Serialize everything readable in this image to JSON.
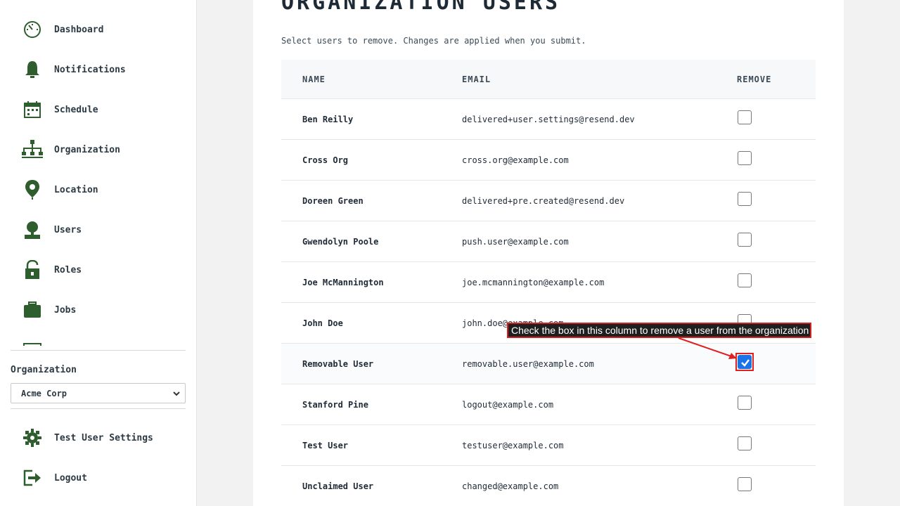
{
  "sidebar": {
    "items": [
      {
        "label": "Dashboard",
        "icon": "dashboard-icon"
      },
      {
        "label": "Notifications",
        "icon": "bell-icon"
      },
      {
        "label": "Schedule",
        "icon": "calendar-icon"
      },
      {
        "label": "Organization",
        "icon": "org-chart-icon"
      },
      {
        "label": "Location",
        "icon": "map-pin-icon"
      },
      {
        "label": "Users",
        "icon": "user-icon"
      },
      {
        "label": "Roles",
        "icon": "lock-icon"
      },
      {
        "label": "Jobs",
        "icon": "briefcase-icon"
      }
    ],
    "organization_label": "Organization",
    "organization_selected": "Acme Corp",
    "footer_items": [
      {
        "label": "Test User Settings",
        "icon": "gear-icon"
      },
      {
        "label": "Logout",
        "icon": "logout-icon"
      }
    ]
  },
  "main": {
    "title": "ORGANIZATION USERS",
    "subtitle": "Select users to remove. Changes are applied when you submit.",
    "columns": [
      "NAME",
      "EMAIL",
      "REMOVE"
    ],
    "rows": [
      {
        "name": "Ben Reilly",
        "email": "delivered+user.settings@resend.dev",
        "remove": false
      },
      {
        "name": "Cross Org",
        "email": "cross.org@example.com",
        "remove": false
      },
      {
        "name": "Doreen Green",
        "email": "delivered+pre.created@resend.dev",
        "remove": false
      },
      {
        "name": "Gwendolyn Poole",
        "email": "push.user@example.com",
        "remove": false
      },
      {
        "name": "Joe McMannington",
        "email": "joe.mcmannington@example.com",
        "remove": false
      },
      {
        "name": "John Doe",
        "email": "john.doe@example.com",
        "remove": false
      },
      {
        "name": "Removable User",
        "email": "removable.user@example.com",
        "remove": true
      },
      {
        "name": "Stanford Pine",
        "email": "logout@example.com",
        "remove": false
      },
      {
        "name": "Test User",
        "email": "testuser@example.com",
        "remove": false
      },
      {
        "name": "Unclaimed User",
        "email": "changed@example.com",
        "remove": false
      }
    ]
  },
  "annotation": {
    "text": "Check the box in this column to remove a user from the organization"
  },
  "colors": {
    "icon_green": "#2e5e2e",
    "accent_blue": "#1a73e8",
    "annotation_red": "#d32020"
  }
}
